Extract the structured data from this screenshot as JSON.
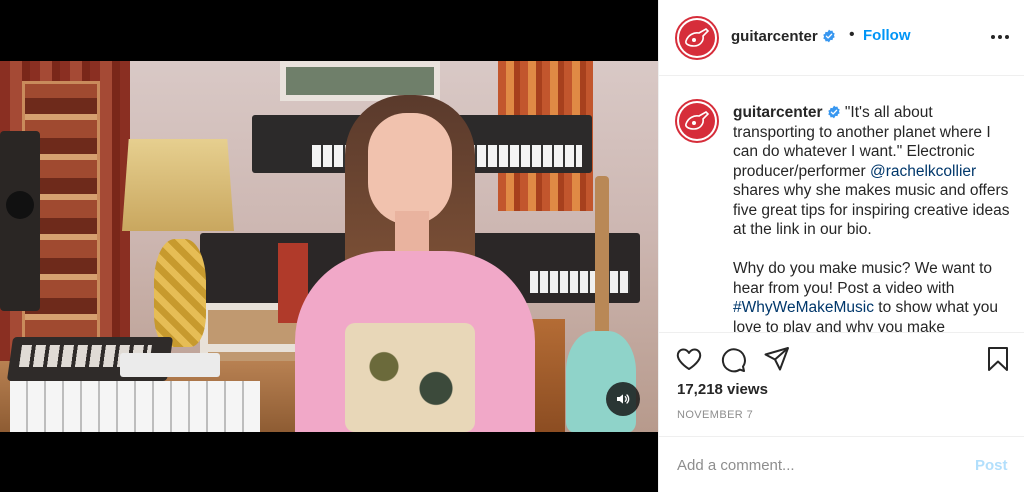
{
  "post": {
    "username": "guitarcenter",
    "follow_label": "Follow",
    "separator": "•",
    "views": "17,218 views",
    "date": "NOVEMBER 7"
  },
  "caption": {
    "username": "guitarcenter",
    "text_1": " \"It's all about transporting to another planet where I can do whatever I want.\" Electronic producer/performer ",
    "mention": "@rachelkcollier",
    "text_2": " shares why she makes music and offers five great tips for inspiring creative ideas at the link in our bio.",
    "text_3": "Why do you make music? We want to hear from you! Post a video with ",
    "hashtag": "#WhyWeMakeMusic",
    "text_4": " to show what you love to play and why you make"
  },
  "comment": {
    "placeholder": "Add a comment...",
    "post_label": "Post"
  },
  "icons": {
    "header_more": "more-horizontal-icon",
    "verified": "verified-badge-icon",
    "like": "heart-icon",
    "comment": "comment-icon",
    "share": "share-icon",
    "save": "bookmark-icon",
    "volume": "speaker-volume-icon"
  },
  "colors": {
    "brand_red": "#d62d3a",
    "follow_blue": "#0095f6",
    "link_blue": "#00376b",
    "post_disabled": "#b2dffc",
    "verified_blue": "#3897f0"
  }
}
